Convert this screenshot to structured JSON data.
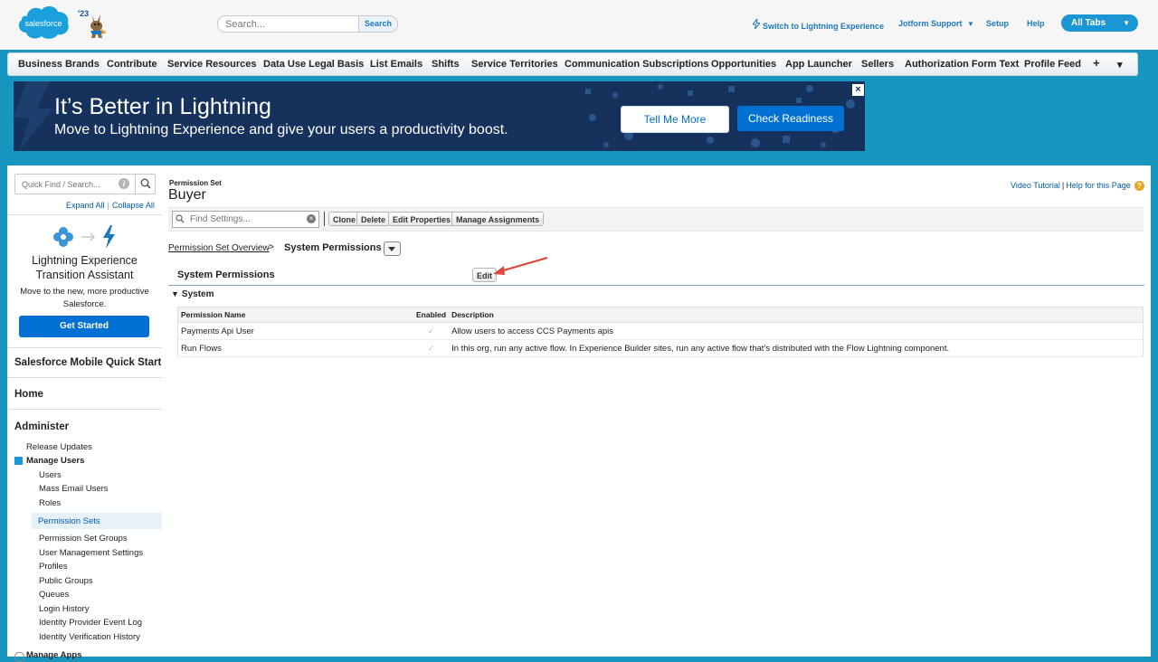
{
  "header": {
    "search_placeholder": "Search...",
    "search_button": "Search",
    "logo_text": "salesforce",
    "logo_year": "'23",
    "switch_lightning": "Switch to Lightning Experience",
    "jotform_support": "Jotform Support",
    "setup": "Setup",
    "help": "Help",
    "all_tabs": "All Tabs"
  },
  "tabs": {
    "items": [
      "Business Brands",
      "Contribute",
      "Service Resources",
      "Data Use Legal Basis",
      "List Emails",
      "Shifts",
      "Service Territories",
      "Communication Subscriptions",
      "Opportunities",
      "App Launcher",
      "Sellers",
      "Authorization Form Text",
      "Profile Feed"
    ],
    "plus": "+",
    "more": "▾"
  },
  "banner": {
    "title": "It’s Better in Lightning",
    "subtitle": "Move to Lightning Experience and give your users a productivity boost.",
    "tell_me_more": "Tell Me More",
    "check_readiness": "Check Readiness",
    "close": "×"
  },
  "sidebar": {
    "quickfind_placeholder": "Quick Find / Search...",
    "expand_all": "Expand All",
    "collapse_all": "Collapse All",
    "transition": {
      "title": "Lightning Experience Transition Assistant",
      "description": "Move to the new, more productive Salesforce.",
      "button": "Get Started"
    },
    "mobile_quick_start": "Salesforce Mobile Quick Start",
    "home": "Home",
    "administer": "Administer",
    "release_updates": "Release Updates",
    "manage_users": "Manage Users",
    "manage_users_items": [
      "Users",
      "Mass Email Users",
      "Roles",
      "Permission Sets",
      "Permission Set Groups",
      "User Management Settings",
      "Profiles",
      "Public Groups",
      "Queues",
      "Login History",
      "Identity Provider Event Log",
      "Identity Verification History"
    ],
    "manage_apps": "Manage Apps"
  },
  "content": {
    "label": "Permission Set",
    "title": "Buyer",
    "video_tutorial": "Video Tutorial",
    "help_for_page": "Help for this Page",
    "find_settings_placeholder": "Find Settings...",
    "buttons": {
      "clone": "Clone",
      "delete": "Delete",
      "edit_properties": "Edit Properties",
      "manage_assignments": "Manage Assignments"
    },
    "breadcrumb": {
      "overview": "Permission Set Overview",
      "separator": ">",
      "current": "System Permissions"
    },
    "section_title": "System Permissions",
    "edit_button": "Edit",
    "subsection": "System",
    "table": {
      "headers": [
        "Permission Name",
        "Enabled",
        "Description"
      ],
      "rows": [
        {
          "name": "Payments Api User",
          "enabled": true,
          "description": "Allow users to access CCS Payments apis"
        },
        {
          "name": "Run Flows",
          "enabled": true,
          "description": "In this org, run any active flow. In Experience Builder sites, run any active flow that’s distributed with the Flow Lightning component."
        }
      ]
    }
  },
  "colors": {
    "page_background": "#1797c0",
    "banner_background": "#16325c",
    "primary_button": "#0070d2",
    "link": "#015ba7",
    "annotation_arrow": "#e0453a"
  }
}
